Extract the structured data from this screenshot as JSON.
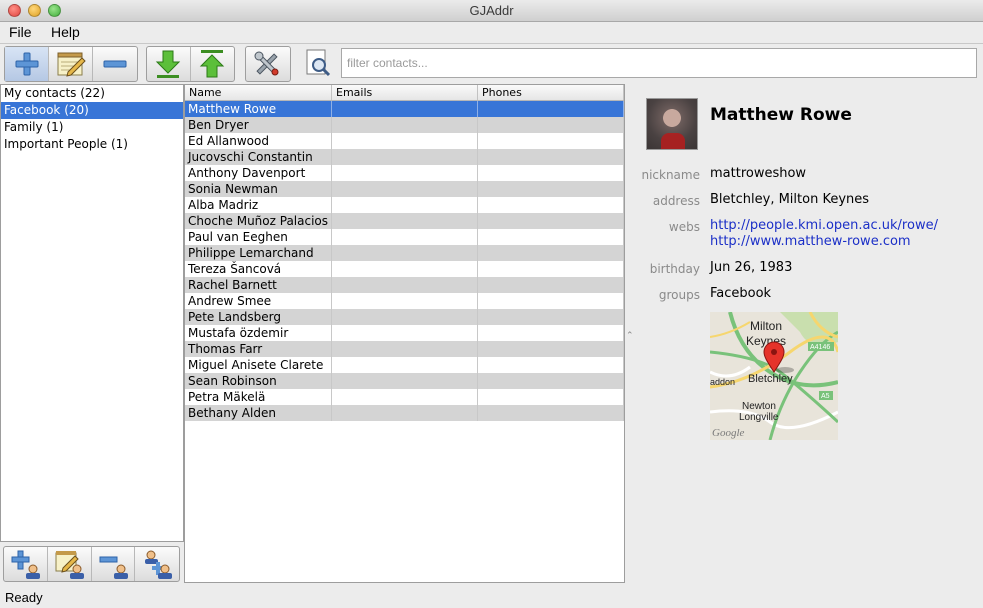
{
  "window": {
    "title": "GJAddr"
  },
  "menu": {
    "file": "File",
    "help": "Help"
  },
  "toolbar": {
    "icons": [
      "add-contact-icon",
      "edit-contact-icon",
      "remove-contact-icon",
      "import-icon",
      "export-icon",
      "preferences-icon",
      "search-icon"
    ]
  },
  "filter": {
    "placeholder": "filter contacts...",
    "value": ""
  },
  "groups": [
    {
      "label": "My contacts (22)",
      "selected": false
    },
    {
      "label": "Facebook (20)",
      "selected": true
    },
    {
      "label": "Family (1)",
      "selected": false
    },
    {
      "label": "Important People (1)",
      "selected": false
    }
  ],
  "group_tools": {
    "icons": [
      "add-group-icon",
      "edit-group-icon",
      "remove-group-icon",
      "merge-groups-icon"
    ]
  },
  "table": {
    "columns": [
      "Name",
      "Emails",
      "Phones"
    ],
    "rows": [
      [
        "Matthew Rowe",
        "",
        ""
      ],
      [
        "Ben Dryer",
        "",
        ""
      ],
      [
        "Ed Allanwood",
        "",
        ""
      ],
      [
        "Jucovschi Constantin",
        "",
        ""
      ],
      [
        "Anthony Davenport",
        "",
        ""
      ],
      [
        "Sonia Newman",
        "",
        ""
      ],
      [
        "Alba Madriz",
        "",
        ""
      ],
      [
        "Choche Muñoz Palacios",
        "",
        ""
      ],
      [
        "Paul van Eeghen",
        "",
        ""
      ],
      [
        "Philippe Lemarchand",
        "",
        ""
      ],
      [
        "Tereza Šancová",
        "",
        ""
      ],
      [
        "Rachel Barnett",
        "",
        ""
      ],
      [
        "Andrew Smee",
        "",
        ""
      ],
      [
        "Pete Landsberg",
        "",
        ""
      ],
      [
        "Mustafa özdemir",
        "",
        ""
      ],
      [
        "Thomas Farr",
        "",
        ""
      ],
      [
        "Miguel Anisete Clarete",
        "",
        ""
      ],
      [
        "Sean Robinson",
        "",
        ""
      ],
      [
        "Petra Mäkelä",
        "",
        ""
      ],
      [
        "Bethany Alden",
        "",
        ""
      ]
    ],
    "selected_index": 0
  },
  "detail": {
    "name": "Matthew Rowe",
    "nickname_label": "nickname",
    "nickname": "mattroweshow",
    "address_label": "address",
    "address": "Bletchley, Milton Keynes",
    "webs_label": "webs",
    "webs": [
      "http://people.kmi.open.ac.uk/rowe/",
      "http://www.matthew-rowe.com"
    ],
    "birthday_label": "birthday",
    "birthday": "Jun 26, 1983",
    "groups_label": "groups",
    "groups": "Facebook",
    "map": {
      "labels": [
        "Milton",
        "Keynes",
        "Bletchley",
        "Newton",
        "Longville",
        "addon",
        "A4146",
        "A5"
      ],
      "watermark": "Google",
      "colors": {
        "land": "#e8e4da",
        "park": "#c9dfae",
        "road_major": "#79c27a",
        "road_a": "#f6d66e",
        "marker": "#e5332a"
      }
    }
  },
  "status": {
    "text": "Ready"
  }
}
